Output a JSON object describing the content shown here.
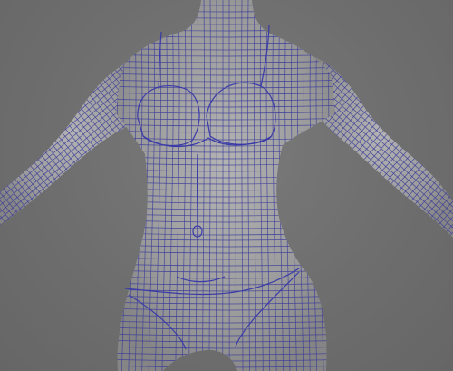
{
  "viewport": {
    "background": "#6f6f6f",
    "model_fill": "#9d9d9d",
    "wire_color": "#3a3a9a",
    "edge_highlight": "#4a4ab8",
    "content": "wireframe-mesh-female-torso"
  }
}
